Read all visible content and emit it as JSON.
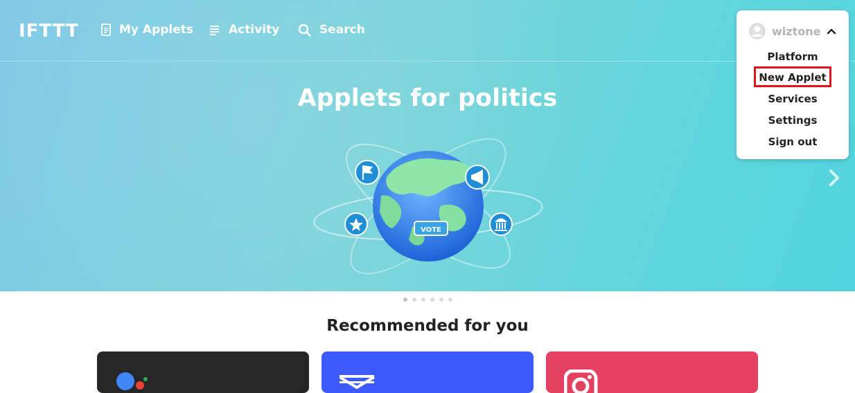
{
  "brand": {
    "logo_text": "IFTTT"
  },
  "nav": {
    "my_applets": "My Applets",
    "activity": "Activity",
    "search": "Search"
  },
  "hero": {
    "title": "Applets for politics",
    "vote_label": "VOTE",
    "carousel_pages": 6,
    "active_page": 1
  },
  "user_menu": {
    "username": "wiztone",
    "items": [
      "Platform",
      "New Applet",
      "Services",
      "Settings",
      "Sign out"
    ],
    "highlighted_item": "New Applet"
  },
  "recommended": {
    "heading": "Recommended for you",
    "cards": [
      {
        "color": "#262626",
        "icon": "google-assistant-icon"
      },
      {
        "color": "#3d5afe",
        "icon": "email-icon"
      },
      {
        "color": "#e4405f",
        "icon": "instagram-icon"
      }
    ]
  },
  "colors": {
    "hero_start": "#7fc9e6",
    "hero_end": "#52d3df",
    "highlight": "#e0141e"
  }
}
